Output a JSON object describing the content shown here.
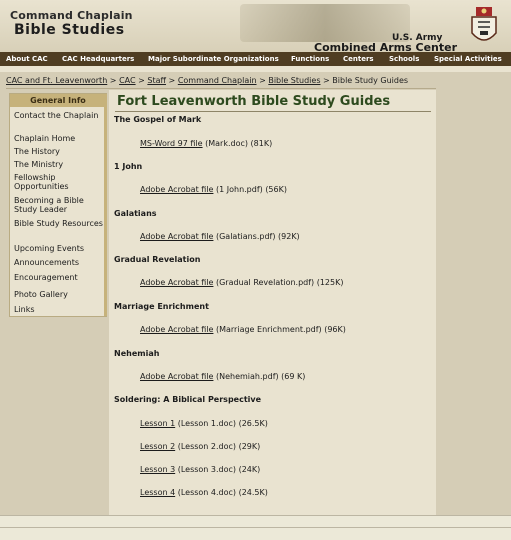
{
  "banner": {
    "title_line1": "Command Chaplain",
    "title_line2": "Bible Studies",
    "army_line1": "U.S. Army",
    "army_line2": "Combined Arms Center"
  },
  "nav": {
    "items": [
      "About CAC",
      "CAC Headquarters",
      "Major Subordinate Organizations",
      "Functions",
      "Centers",
      "Schools",
      "Special Activities"
    ]
  },
  "breadcrumb": {
    "links": [
      "CAC and Ft. Leavenworth",
      "CAC",
      "Staff",
      "Command Chaplain",
      "Bible Studies"
    ],
    "separator": " > ",
    "current": "Bible Study Guides"
  },
  "sidebar": {
    "heading": "General Info",
    "items": [
      "Contact the Chaplain",
      "Chaplain Home",
      "The History",
      "The Ministry",
      "Fellowship Opportunities",
      "Becoming a Bible Study Leader",
      "Bible Study Resources",
      "Upcoming Events",
      "Announcements",
      "Encouragement",
      "Photo Gallery",
      "Links"
    ]
  },
  "main": {
    "title": "Fort Leavenworth Bible Study Guides",
    "sections": [
      {
        "heading": "The Gospel of Mark",
        "files": [
          {
            "link": "MS-Word 97 file",
            "detail": "(Mark.doc) (81K)"
          }
        ]
      },
      {
        "heading": "1 John",
        "files": [
          {
            "link": "Adobe Acrobat file",
            "detail": "(1 John.pdf) (56K)"
          }
        ]
      },
      {
        "heading": "Galatians",
        "files": [
          {
            "link": "Adobe Acrobat file",
            "detail": "(Galatians.pdf) (92K)"
          }
        ]
      },
      {
        "heading": "Gradual Revelation",
        "files": [
          {
            "link": "Adobe Acrobat file",
            "detail": "(Gradual Revelation.pdf) (125K)"
          }
        ]
      },
      {
        "heading": "Marriage Enrichment",
        "files": [
          {
            "link": "Adobe Acrobat file",
            "detail": "(Marriage Enrichment.pdf) (96K)"
          }
        ]
      },
      {
        "heading": "Nehemiah",
        "files": [
          {
            "link": "Adobe Acrobat file",
            "detail": "(Nehemiah.pdf) (69 K)"
          }
        ]
      },
      {
        "heading": "Soldering: A Biblical Perspective",
        "files": [
          {
            "link": "Lesson 1",
            "detail": "(Lesson 1.doc) (26.5K)"
          },
          {
            "link": "Lesson 2",
            "detail": "(Lesson 2.doc) (29K)"
          },
          {
            "link": "Lesson 3",
            "detail": "(Lesson 3.doc) (24K)"
          },
          {
            "link": "Lesson 4",
            "detail": "(Lesson 4.doc) (24.5K)"
          }
        ]
      }
    ]
  }
}
